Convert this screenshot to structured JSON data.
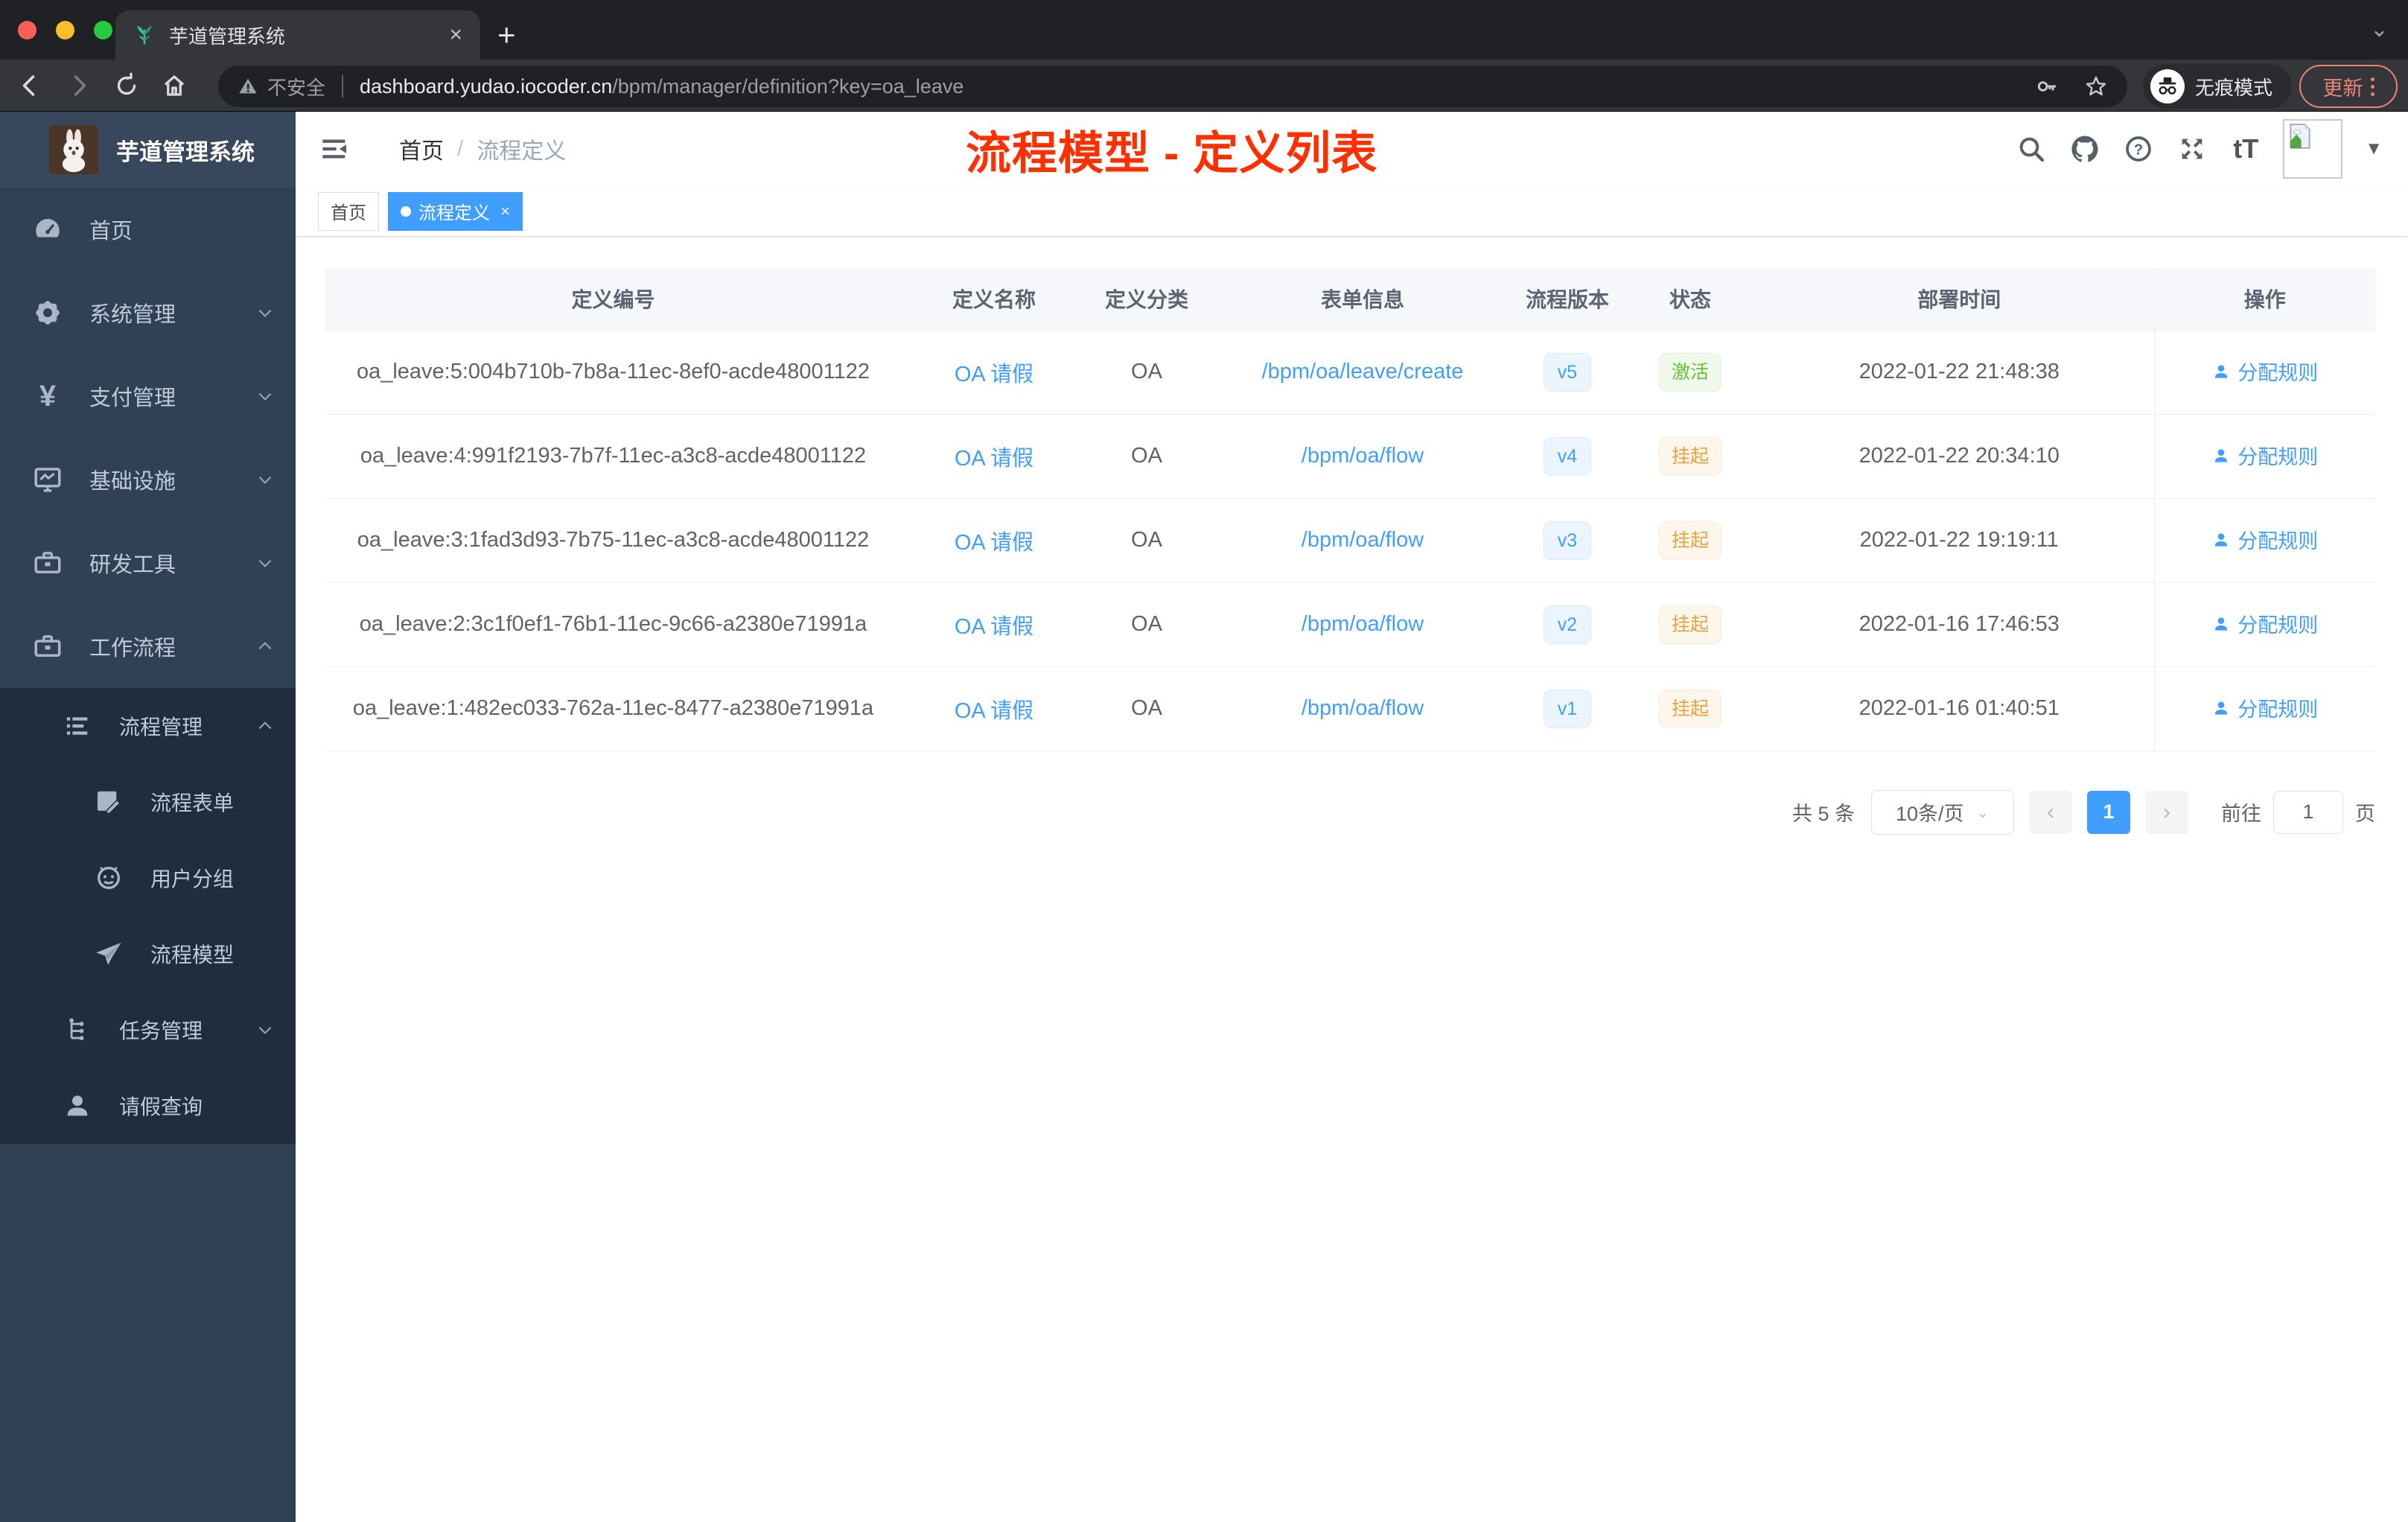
{
  "browser": {
    "tab": {
      "title": "芋道管理系统",
      "close": "×",
      "new_tab": "+",
      "strip_caret": "⌄"
    },
    "address": {
      "security": "不安全",
      "host": "dashboard.yudao.iocoder.cn",
      "path": "/bpm/manager/definition?key=oa_leave"
    },
    "incognito_label": "无痕模式",
    "update_label": "更新"
  },
  "sidebar": {
    "logo_title": "芋道管理系统",
    "items": [
      {
        "label": "首页",
        "icon": "dashboard-icon"
      },
      {
        "label": "系统管理",
        "icon": "gear-icon",
        "chevron": "down"
      },
      {
        "label": "支付管理",
        "icon": "yen-icon",
        "chevron": "down"
      },
      {
        "label": "基础设施",
        "icon": "monitor-icon",
        "chevron": "down"
      },
      {
        "label": "研发工具",
        "icon": "toolbox-icon",
        "chevron": "down"
      },
      {
        "label": "工作流程",
        "icon": "briefcase-icon",
        "chevron": "up"
      }
    ],
    "submenu": {
      "title": {
        "label": "流程管理",
        "icon": "list-icon",
        "chevron": "up"
      },
      "children": [
        {
          "label": "流程表单",
          "icon": "form-icon"
        },
        {
          "label": "用户分组",
          "icon": "user-group-icon"
        },
        {
          "label": "流程模型",
          "icon": "paper-plane-icon"
        }
      ],
      "siblings": [
        {
          "label": "任务管理",
          "icon": "tree-icon",
          "chevron": "down"
        },
        {
          "label": "请假查询",
          "icon": "user-icon"
        }
      ]
    }
  },
  "navbar": {
    "breadcrumb": {
      "home": "首页",
      "separator": "/",
      "current": "流程定义"
    },
    "annotation": "流程模型 - 定义列表",
    "font_size_icon_label": "tT"
  },
  "tags": {
    "home": "首页",
    "active": "流程定义",
    "close": "×"
  },
  "table": {
    "headers": [
      "定义编号",
      "定义名称",
      "定义分类",
      "表单信息",
      "流程版本",
      "状态",
      "部署时间",
      "操作"
    ],
    "action_label": "分配规则",
    "rows": [
      {
        "id": "oa_leave:5:004b710b-7b8a-11ec-8ef0-acde48001122",
        "name": "OA 请假",
        "category": "OA",
        "form": "/bpm/oa/leave/create",
        "version": "v5",
        "status": "激活",
        "status_type": "success",
        "time": "2022-01-22 21:48:38"
      },
      {
        "id": "oa_leave:4:991f2193-7b7f-11ec-a3c8-acde48001122",
        "name": "OA 请假",
        "category": "OA",
        "form": "/bpm/oa/flow",
        "version": "v4",
        "status": "挂起",
        "status_type": "warning",
        "time": "2022-01-22 20:34:10"
      },
      {
        "id": "oa_leave:3:1fad3d93-7b75-11ec-a3c8-acde48001122",
        "name": "OA 请假",
        "category": "OA",
        "form": "/bpm/oa/flow",
        "version": "v3",
        "status": "挂起",
        "status_type": "warning",
        "time": "2022-01-22 19:19:11"
      },
      {
        "id": "oa_leave:2:3c1f0ef1-76b1-11ec-9c66-a2380e71991a",
        "name": "OA 请假",
        "category": "OA",
        "form": "/bpm/oa/flow",
        "version": "v2",
        "status": "挂起",
        "status_type": "warning",
        "time": "2022-01-16 17:46:53"
      },
      {
        "id": "oa_leave:1:482ec033-762a-11ec-8477-a2380e71991a",
        "name": "OA 请假",
        "category": "OA",
        "form": "/bpm/oa/flow",
        "version": "v1",
        "status": "挂起",
        "status_type": "warning",
        "time": "2022-01-16 01:40:51"
      }
    ]
  },
  "pagination": {
    "total": "共 5 条",
    "page_size": "10条/页",
    "prev": "‹",
    "page": "1",
    "next": "›",
    "goto_label": "前往",
    "goto_value": "1",
    "unit_label": "页"
  },
  "colors": {
    "accent": "#409eff",
    "success": "#67c23a",
    "warning": "#e6a23c",
    "annotation_red": "#ff3000",
    "sidebar_bg": "#304156",
    "submenu_bg": "#1f2d3d",
    "chrome_dark": "#202124",
    "chrome_toolbar": "#35363a",
    "update_salmon": "#ee8277"
  }
}
